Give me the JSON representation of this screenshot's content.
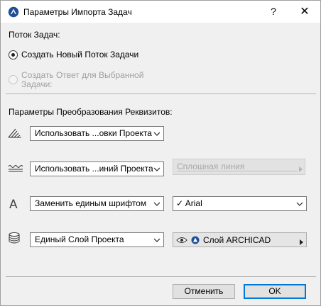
{
  "window": {
    "title": "Параметры Импорта Задач",
    "help": "?",
    "close": "✕"
  },
  "flow": {
    "heading": "Поток Задач:",
    "option_new": "Создать Новый Поток Задачи",
    "option_reply_line1": "Создать Ответ для Выбранной",
    "option_reply_line2": "Задачи:"
  },
  "conversion": {
    "heading": "Параметры Преобразования Реквизитов:",
    "hatch_combo": "Использовать ...овки Проекта",
    "line_combo": "Использовать ...иний Проекта",
    "line_type_value": "Сплошная линия",
    "font_combo": "Заменить единым шрифтом",
    "font_check": "✓",
    "font_value": "Arial",
    "layer_combo": "Единый Слой Проекта",
    "layer_value": "Слой ARCHICAD"
  },
  "buttons": {
    "cancel": "Отменить",
    "ok": "OK"
  },
  "colors": {
    "accent": "#0078d7",
    "app_icon": "#1f4f96"
  }
}
